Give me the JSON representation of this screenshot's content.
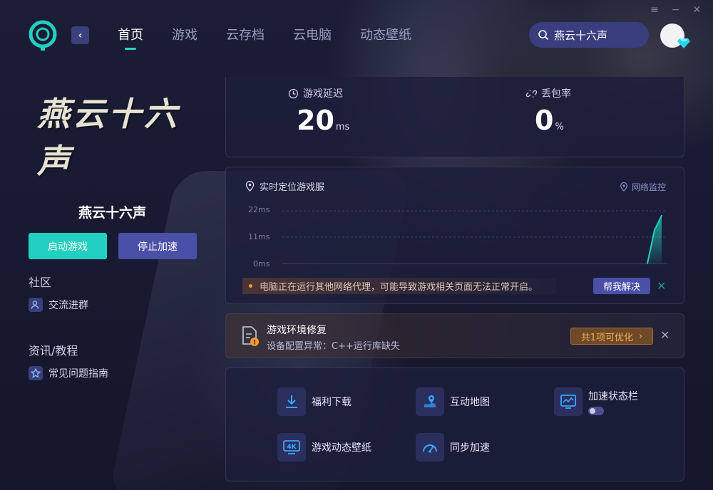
{
  "nav": {
    "back_icon": "chevron-left-icon",
    "items": [
      "首页",
      "游戏",
      "云存档",
      "云电脑",
      "动态壁纸"
    ],
    "active_index": 0
  },
  "search": {
    "value": "燕云十六声"
  },
  "window_controls": [
    "≡",
    "−",
    "✕"
  ],
  "game": {
    "logo_text": "燕云十六声",
    "title": "燕云十六声",
    "start_label": "启动游戏",
    "stop_label": "停止加速"
  },
  "community": {
    "heading": "社区",
    "links": [
      {
        "label": "交流进群",
        "icon": "user-group-icon"
      }
    ]
  },
  "news": {
    "heading": "资讯/教程",
    "links": [
      {
        "label": "常见问题指南",
        "icon": "star-icon"
      }
    ]
  },
  "stats": {
    "latency": {
      "label": "游戏延迟",
      "value": "20",
      "unit": "ms"
    },
    "packet_loss": {
      "label": "丢包率",
      "value": "0",
      "unit": "%"
    }
  },
  "chart_panel": {
    "title": "实时定位游戏服",
    "monitor_label": "网络监控",
    "ticks": [
      "22ms",
      "11ms",
      "0ms"
    ]
  },
  "chart_data": {
    "type": "area",
    "ylim": [
      0,
      22
    ],
    "yticks": [
      "22ms",
      "11ms",
      "0ms"
    ],
    "x": [
      0,
      1,
      2
    ],
    "series": [
      {
        "values": [
          0,
          14,
          20
        ]
      }
    ]
  },
  "warning": {
    "text": "电脑正在运行其他网络代理，可能导致游戏相关页面无法正常开启。",
    "action_label": "帮我解决"
  },
  "repair": {
    "title": "游戏环境修复",
    "desc": "设备配置异常：C++运行库缺失",
    "action_label": "共1项可优化"
  },
  "tools": [
    {
      "label": "福利下载",
      "icon": "download-icon"
    },
    {
      "label": "互动地图",
      "icon": "map-icon"
    },
    {
      "label": "加速状态栏",
      "icon": "monitor-chart-icon"
    },
    {
      "label": "游戏动态壁纸",
      "icon": "4k-icon"
    },
    {
      "label": "同步加速",
      "icon": "speedometer-icon"
    }
  ],
  "colors": {
    "accent": "#22cfc0",
    "primary_btn": "#4a4fa8",
    "warning": "#f39b2e"
  }
}
